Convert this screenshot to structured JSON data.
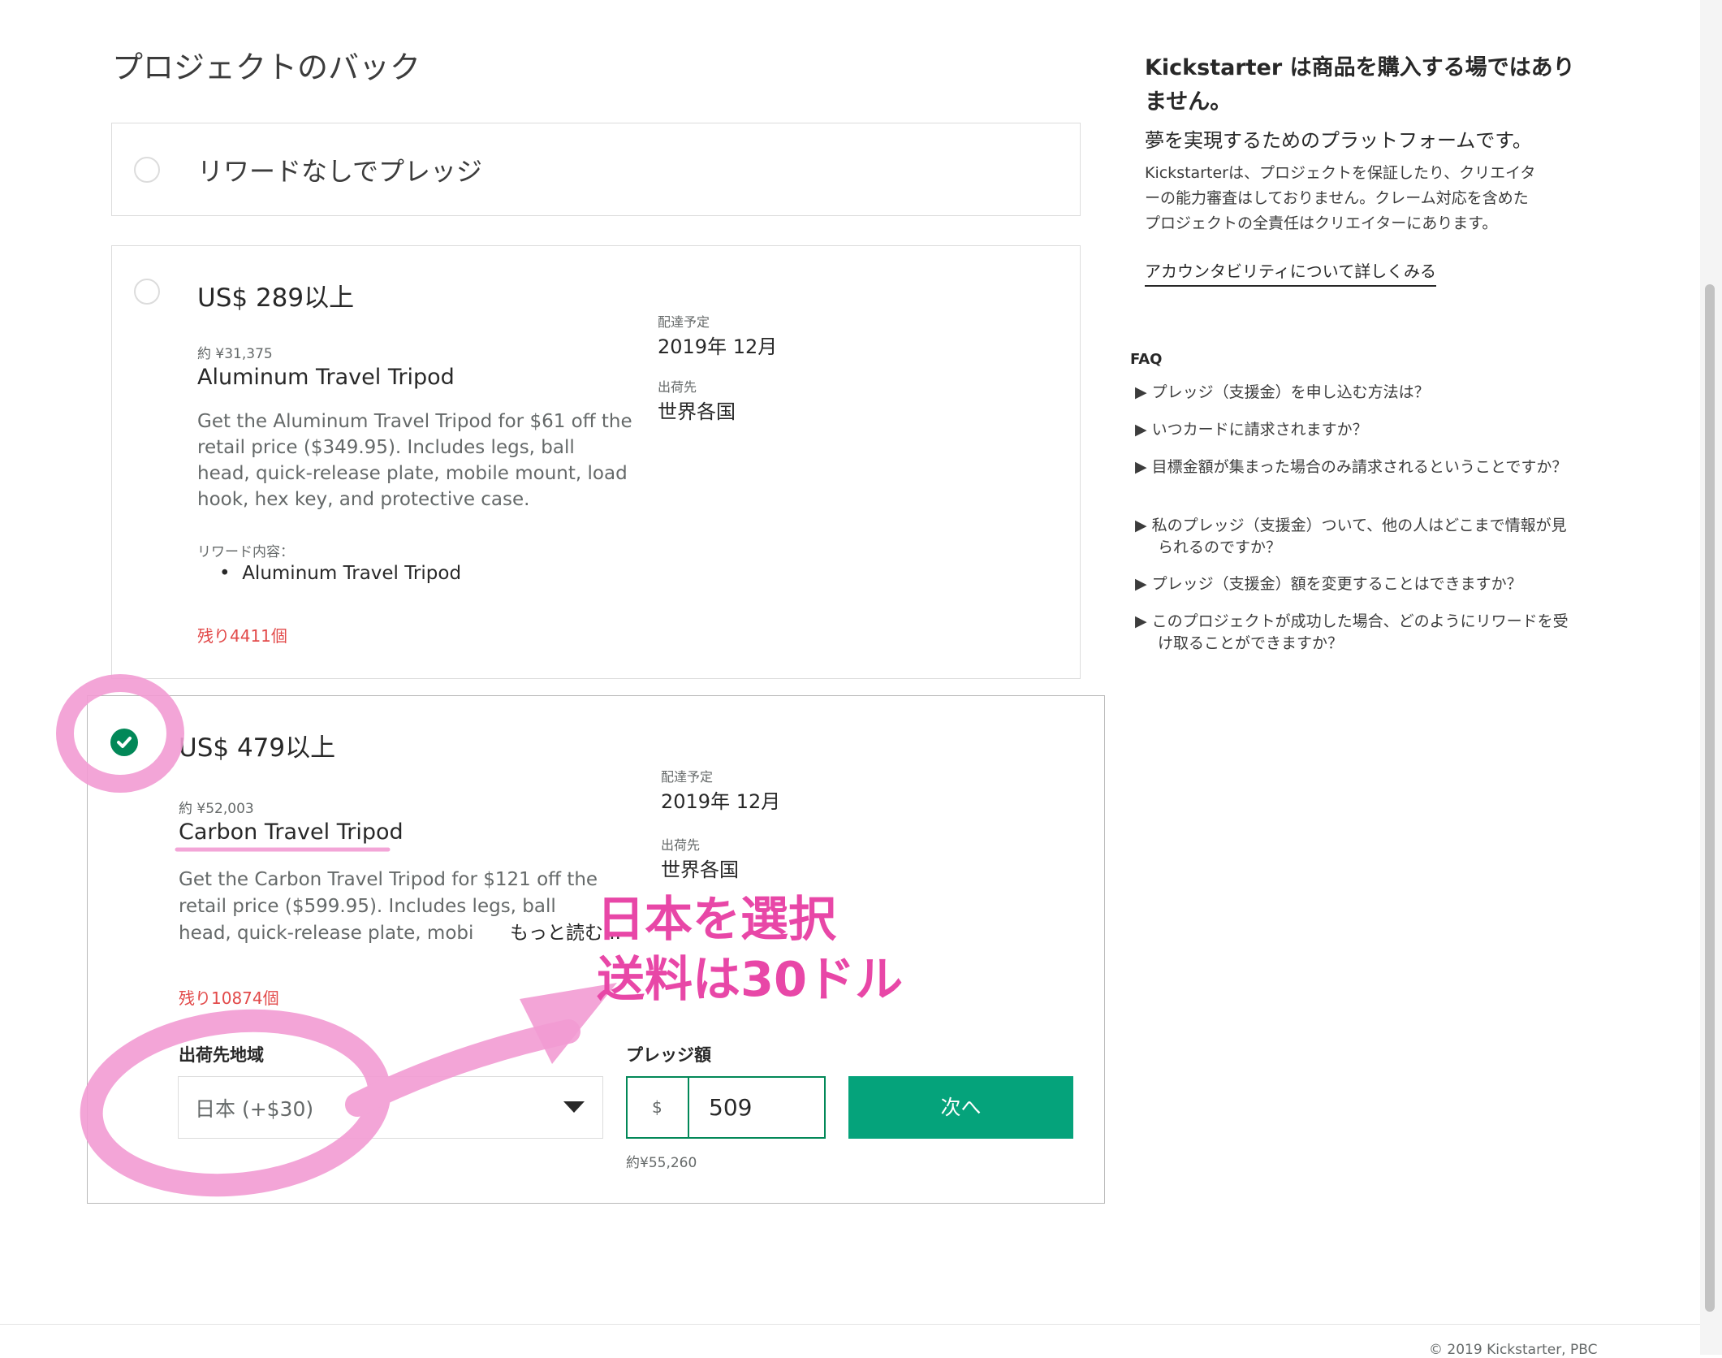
{
  "page_title": "プロジェクトのバック",
  "no_reward": {
    "label": "リワードなしでプレッジ"
  },
  "reward1": {
    "price": "US$ 289以上",
    "jpy": "約 ¥31,375",
    "title": "Aluminum Travel Tripod",
    "desc_lines": [
      "Get the Aluminum Travel Tripod for $61 off the",
      "retail price ($349.95). Includes legs, ball",
      "head, quick-release plate, mobile mount, load",
      "hook, hex key, and protective case."
    ],
    "delivery_label": "配達予定",
    "delivery_value": "2019年 12月",
    "ship_label": "出荷先",
    "ship_value": "世界各国",
    "contents_label": "リワード内容：",
    "contents_item": "Aluminum Travel Tripod",
    "remaining": "残り4411個"
  },
  "reward2": {
    "price": "US$ 479以上",
    "jpy": "約 ¥52,003",
    "title": "Carbon Travel Tripod",
    "desc_lines": [
      "Get the Carbon Travel Tripod for $121 off the",
      "retail price ($599.95). Includes legs, ball",
      "head, quick-release plate, mobi"
    ],
    "read_more": "もっと読む...",
    "delivery_label": "配達予定",
    "delivery_value": "2019年 12月",
    "ship_label": "出荷先",
    "ship_value": "世界各国",
    "remaining": "残り10874個",
    "region_label": "出荷先地域",
    "region_value": "日本 (+$30)",
    "pledge_label": "プレッジ額",
    "currency": "$",
    "amount": "509",
    "approx": "約¥55,260",
    "next_label": "次へ"
  },
  "annotation": {
    "line1": "日本を選択",
    "line2": "送料は30ドル",
    "color": "#e847a7"
  },
  "sidebar": {
    "heading_line1": "Kickstarter は商品を購入する場ではあり",
    "heading_line2": "ません。",
    "subheading": "夢を実現するためのプラットフォームです。",
    "para_lines": [
      "Kickstarterは、プロジェクトを保証したり、クリエイタ",
      "ーの能力審査はしておりません。クレーム対応を含めた",
      "プロジェクトの全責任はクリエイターにあります。"
    ],
    "link": "アカウンタビリティについて詳しくみる",
    "faq_title": "FAQ",
    "faq": [
      "▶ プレッジ（支援金）を申し込む方法は？",
      "▶ いつカードに請求されますか？",
      "▶ 目標金額が集まった場合のみ請求されるということですか？",
      "▶ 私のプレッジ（支援金）ついて、他の人はどこまで情報が見られるのですか？",
      "▶ プレッジ（支援金）額を変更することはできますか？",
      "▶ このプロジェクトが成功した場合、どのようにリワードを受け取ることができますか？"
    ]
  },
  "footer": {
    "text": "© 2019 Kickstarter, PBC"
  },
  "colors": {
    "accent_green": "#028858",
    "button_green": "#05a37b",
    "remaining_red": "#e24a4a",
    "annotation_pink": "#e847a7"
  }
}
